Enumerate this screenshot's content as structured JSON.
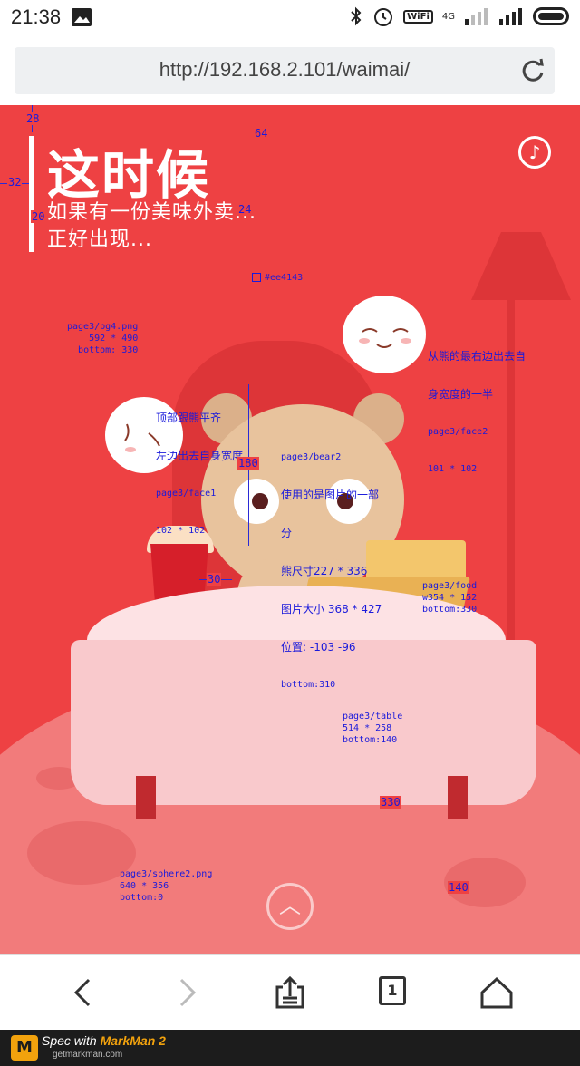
{
  "status_bar": {
    "time": "21:38",
    "network_label": "4G",
    "wifi_label": "WiFi",
    "icons": [
      "image-notification-icon",
      "bluetooth-icon",
      "alarm-icon",
      "wifi-icon",
      "signal-icon",
      "signal-icon",
      "battery-icon"
    ]
  },
  "browser": {
    "url": "http://192.168.2.101/waimai/",
    "refresh_icon": "refresh-icon",
    "tab_count": "1",
    "nav": [
      "back-icon",
      "forward-icon",
      "share-icon",
      "tabs-icon",
      "home-icon"
    ]
  },
  "page": {
    "title": "这时候",
    "subtitle_line1": "如果有一份美味外卖...",
    "subtitle_line2": "正好出现...",
    "background_color": "#ee4143",
    "music_icon": "music-note-icon",
    "up_icon": "chevron-up-icon"
  },
  "annotations": {
    "dim_28": "28",
    "dim_64": "64",
    "dim_32": "32",
    "dim_24": "24",
    "dim_20": "20",
    "color_label": "#ee4143",
    "bg4_line1": "page3/bg4.png",
    "bg4_line2": "592 * 490",
    "bg4_line3": "bottom: 330",
    "face2_line1": "从熊的最右边出去自",
    "face2_line2": "身宽度的一半",
    "face2_line3": "page3/face2",
    "face2_line4": "101 * 102",
    "face1_line1": "顶部跟熊平齐",
    "face1_line2": "左边出去自身宽度",
    "face1_line3": "page3/face1",
    "face1_line4": "102 * 102",
    "bear_line1": "page3/bear2",
    "bear_line2": "使用的是图片的一部",
    "bear_line3": "分",
    "bear_line4": "熊尺寸227 * 336",
    "bear_line5": "图片大小 368 * 427",
    "bear_line6": "位置: -103 -96",
    "bear_line7": "bottom:310",
    "dim_180": "180",
    "dim_30": "30",
    "food_line1": "page3/food",
    "food_line2": "w354 * 152",
    "food_line3": "bottom:330",
    "table_line1": "page3/table",
    "table_line2": "514 * 258",
    "table_line3": "bottom:140",
    "dim_330": "330",
    "dim_140": "140",
    "sphere_line1": "page3/sphere2.png",
    "sphere_line2": "640 * 356",
    "sphere_line3": "bottom:0"
  },
  "footer": {
    "spec_with": "Spec with",
    "brand": "MarkMan 2",
    "site": "getmarkman.com",
    "logo_letter": "M"
  }
}
